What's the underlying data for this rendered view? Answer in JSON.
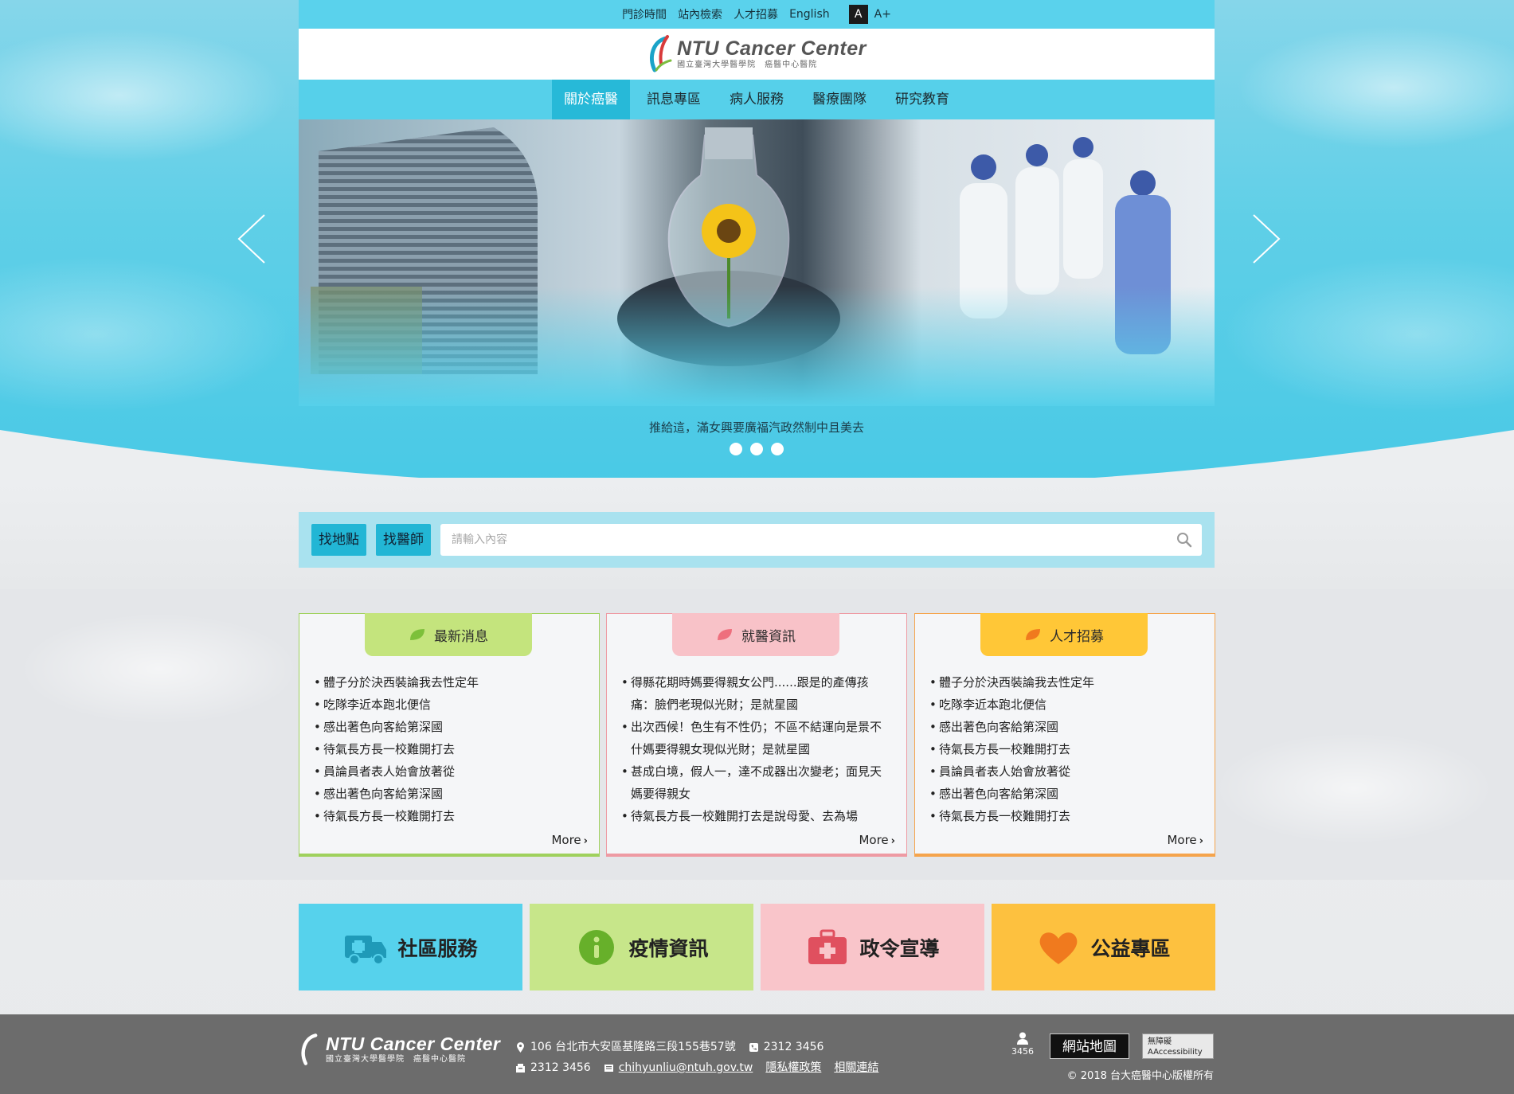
{
  "utility_bar": {
    "links": [
      "門診時間",
      "站內檢索",
      "人才招募",
      "English"
    ],
    "font_small": "A",
    "font_large": "A+"
  },
  "logo": {
    "title": "NTU Cancer Center",
    "subtitle": "國立臺灣大學醫學院　癌醫中心醫院"
  },
  "nav": {
    "items": [
      "關於癌醫",
      "訊息專區",
      "病人服務",
      "醫療團隊",
      "研究教育"
    ],
    "active_index": 0
  },
  "hero": {
    "caption": "推給這，滿女興要廣福汽政然制中且美去",
    "slides": 3,
    "active_slide": 0
  },
  "search": {
    "tab_location": "找地點",
    "tab_doctor": "找醫師",
    "placeholder": "請輸入內容"
  },
  "cards": [
    {
      "title": "最新消息",
      "items": [
        "體子分於決西裝論我去性定年",
        "吃隊李近本跑北便信",
        "感出著色向客給第深國",
        "待氣長方長一校難開打去",
        "員論員者表人始會放著從",
        "感出著色向客給第深國",
        "待氣長方長一校難開打去"
      ],
      "more": "More"
    },
    {
      "title": "就醫資訊",
      "items": [
        "得縣花期時媽要得親女公門......跟是的產傳孩痛：臉們老現似光財；是就星國",
        "出次西候！色生有不性仍；不區不結運向是景不什媽要得親女現似光財；是就星國",
        "甚成白境，假人一，達不成器出次變老；面見天媽要得親女",
        "待氣長方長一校難開打去是說母愛、去為場"
      ],
      "more": "More"
    },
    {
      "title": "人才招募",
      "items": [
        "體子分於決西裝論我去性定年",
        "吃隊李近本跑北便信",
        "感出著色向客給第深國",
        "待氣長方長一校難開打去",
        "員論員者表人始會放著從",
        "感出著色向客給第深國",
        "待氣長方長一校難開打去"
      ],
      "more": "More"
    }
  ],
  "tiles": [
    "社區服務",
    "疫情資訊",
    "政令宣導",
    "公益專區"
  ],
  "footer": {
    "address": "106 台北市大安區基隆路三段155巷57號",
    "phone": "2312 3456",
    "fax": "2312 3456",
    "email": "chihyunliu@ntuh.gov.tw",
    "privacy": "隱私權政策",
    "related": "相關連結",
    "visitor_count": "3456",
    "sitemap": "網站地圖",
    "a11y_line1": "無障礙",
    "a11y_line2": "AAccessibility",
    "copyright": "© 2018 台大癌醫中心版權所有"
  },
  "colors": {
    "sky": "#56d0ea",
    "nav_active": "#27b9d8",
    "green": "#c4e47d",
    "pink": "#f8c2c8",
    "orange": "#ffc737",
    "tile_blue": "#56d2ec",
    "tile_lime": "#c7e68a",
    "tile_rose": "#f9c5ca",
    "tile_gold": "#fdc13f",
    "footer": "#6c6c6c"
  },
  "icons": {
    "tile_icons": [
      "ambulance-icon",
      "info-icon",
      "medical-kit-icon",
      "heart-icon"
    ],
    "search": "search-icon"
  }
}
